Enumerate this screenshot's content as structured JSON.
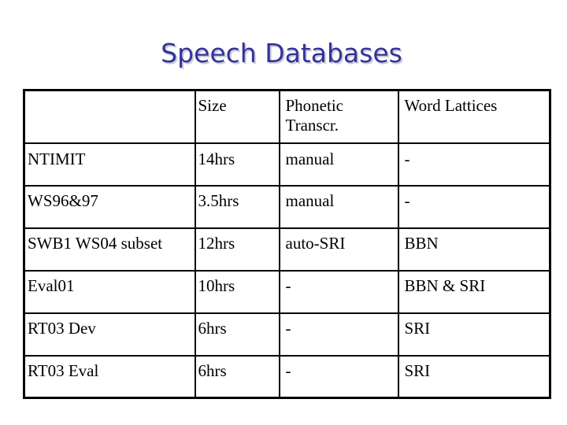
{
  "slide": {
    "title": "Speech Databases"
  },
  "table": {
    "headers": [
      "",
      "Size",
      "Phonetic Transcr.",
      "Word Lattices"
    ],
    "header_lines": {
      "phonetic_line1": "Phonetic",
      "phonetic_line2": "Transcr."
    },
    "rows": [
      {
        "name": "NTIMIT",
        "size": "14hrs",
        "phonetic": "manual",
        "lattices": "-"
      },
      {
        "name": "WS96&97",
        "size": "3.5hrs",
        "phonetic": "manual",
        "lattices": "-"
      },
      {
        "name": "SWB1 WS04 subset",
        "size": "12hrs",
        "phonetic": "auto-SRI",
        "lattices": "BBN"
      },
      {
        "name": "Eval01",
        "size": "10hrs",
        "phonetic": "-",
        "lattices": "BBN & SRI"
      },
      {
        "name": "RT03 Dev",
        "size": "6hrs",
        "phonetic": "-",
        "lattices": "SRI"
      },
      {
        "name": "RT03 Eval",
        "size": "6hrs",
        "phonetic": "-",
        "lattices": "SRI"
      }
    ]
  }
}
